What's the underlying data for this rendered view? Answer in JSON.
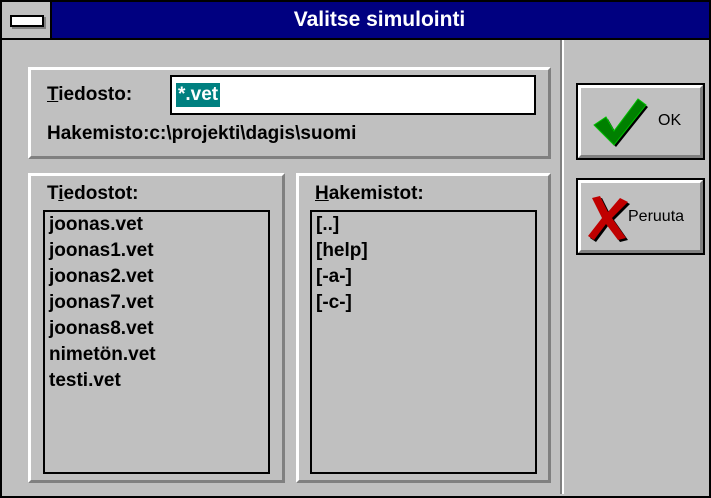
{
  "window": {
    "title": "Valitse simulointi"
  },
  "file_field": {
    "label_accel": "T",
    "label_rest": "iedosto:",
    "value": "*.vet"
  },
  "directory": {
    "label": "Hakemisto:",
    "path": "c:\\projekti\\dagis\\suomi"
  },
  "files_list": {
    "label_pre": "T",
    "label_accel": "i",
    "label_rest": "edostot:",
    "items": [
      "joonas.vet",
      "joonas1.vet",
      "joonas2.vet",
      "joonas7.vet",
      "joonas8.vet",
      "nimetön.vet",
      "testi.vet"
    ]
  },
  "dirs_list": {
    "label_accel": "H",
    "label_rest": "akemistot:",
    "items": [
      "[..]",
      "[help]",
      "[-a-]",
      "[-c-]"
    ]
  },
  "buttons": {
    "ok": "OK",
    "cancel": "Peruuta"
  },
  "colors": {
    "title_bar": "#000080",
    "selection": "#008080",
    "ok_check": "#008000",
    "cancel_x": "#c00000"
  },
  "icons": {
    "ok": "checkmark-icon",
    "cancel": "x-mark-icon",
    "system_menu": "system-menu-icon"
  }
}
